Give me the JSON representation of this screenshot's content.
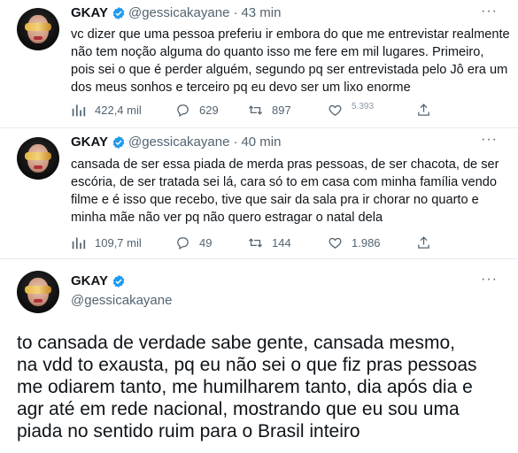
{
  "tweets": [
    {
      "name": "GKAY",
      "handle": "@gessicakayane",
      "dot": "·",
      "time": "43 min",
      "lines": [
        "vc dizer que uma pessoa preferiu ir embora do que me entrevistar realmente",
        "não tem noção alguma do quanto isso me fere em mil lugares. Primeiro,",
        "pois sei o que é perder alguém, segundo pq ser entrevistada pelo Jô era um",
        "dos meus sonhos e terceiro pq eu devo ser um lixo enorme"
      ],
      "views": "422,4 mil",
      "replies": "629",
      "retweets": "897",
      "likes": "5.393"
    },
    {
      "name": "GKAY",
      "handle": "@gessicakayane",
      "dot": "·",
      "time": "40 min",
      "lines": [
        "cansada de ser essa piada de merda pras pessoas, de ser chacota, de ser",
        "escória, de ser tratada sei lá, cara só to em casa com minha família vendo",
        "filme e é isso que recebo, tive que sair da sala pra ir chorar no quarto e",
        "minha mãe não ver pq não quero estragar o natal dela"
      ],
      "views": "109,7 mil",
      "replies": "49",
      "retweets": "144",
      "likes": "1.986"
    },
    {
      "name": "GKAY",
      "handle": "@gessicakayane",
      "lines": [
        "to cansada de verdade sabe gente, cansada mesmo,",
        "na vdd to exausta, pq eu não sei o que fiz pras pessoas",
        "me odiarem tanto, me humilharem tanto, dia após dia e",
        "agr até em rede nacional, mostrando que eu sou uma",
        "piada no sentido ruim para o Brasil inteiro"
      ]
    }
  ],
  "colors": {
    "text": "#0f1419",
    "muted": "#536471",
    "verified": "#1d9bf0",
    "divider": "#e6ecf0"
  },
  "icons": [
    "views-icon",
    "reply-icon",
    "retweet-icon",
    "like-icon",
    "share-icon",
    "more-icon",
    "verified-badge-icon"
  ]
}
